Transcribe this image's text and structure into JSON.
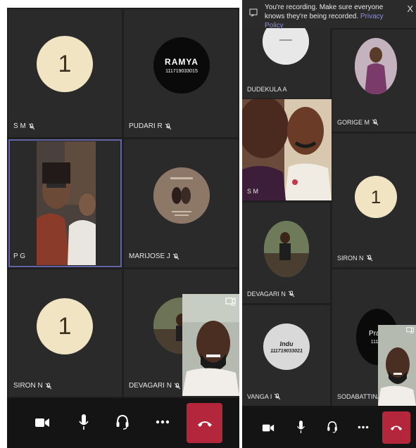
{
  "left_call": {
    "tiles": [
      {
        "name": "S M",
        "avatar_text": "1"
      },
      {
        "name": "PUDARI R",
        "avatar_title": "RAMYA",
        "avatar_sub": "111719033015"
      },
      {
        "name": "P G"
      },
      {
        "name": "MARIJOSE J"
      },
      {
        "name": "SIRON N",
        "avatar_text": "1"
      },
      {
        "name": "DEVAGARI N"
      }
    ]
  },
  "right_call": {
    "banner": {
      "text": "You're recording. Make sure everyone knows they're being recorded.",
      "link": "Privacy Policy",
      "close": "X"
    },
    "tiles": [
      {
        "name": "DUDEKULA A"
      },
      {
        "name": "GORIGE M"
      },
      {
        "name": "S M"
      },
      {
        "name": "SIRON N",
        "avatar_text": "1"
      },
      {
        "name": "DEVAGARI N"
      },
      {
        "name": "VANGA I",
        "avatar_title": "Indu",
        "avatar_sub": "111719033021"
      },
      {
        "name": "SODABATTINA P",
        "avatar_title": "Pram",
        "avatar_sub": "11171"
      }
    ]
  },
  "colors": {
    "hangup": "#b3263c",
    "active_border": "#6264a7",
    "privacy_link": "#8b8df0"
  }
}
